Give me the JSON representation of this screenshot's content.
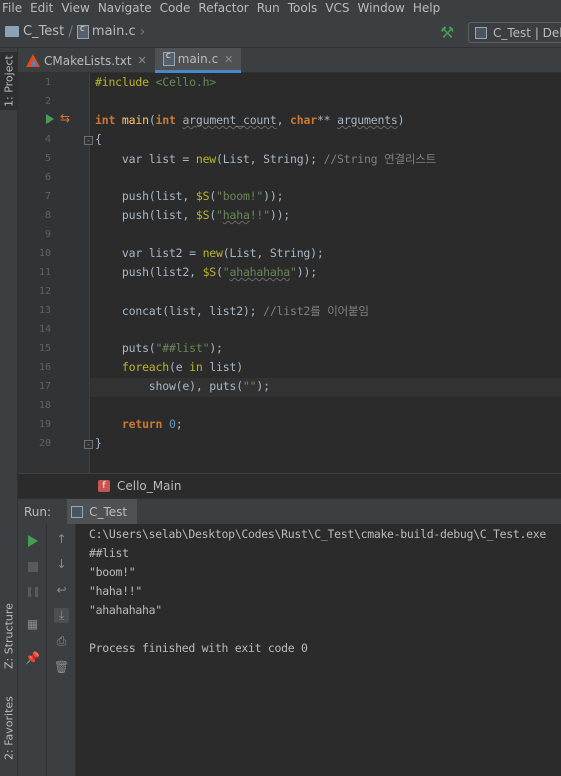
{
  "menu": [
    "File",
    "Edit",
    "View",
    "Navigate",
    "Code",
    "Refactor",
    "Run",
    "Tools",
    "VCS",
    "Window",
    "Help"
  ],
  "nav": {
    "project": "C_Test",
    "file": "main.c",
    "run_config": "C_Test | Deb"
  },
  "left_tools": {
    "project_tab": "1: Project",
    "structure_tab": "Z: Structure",
    "favorites_tab": "2: Favorites"
  },
  "tabs": [
    {
      "label": "CMakeLists.txt",
      "icon": "cmake-icon",
      "active": false
    },
    {
      "label": "main.c",
      "icon": "c-file-icon",
      "active": true
    }
  ],
  "line_numbers": [
    "1",
    "2",
    "3",
    "4",
    "5",
    "6",
    "7",
    "8",
    "9",
    "10",
    "11",
    "12",
    "13",
    "14",
    "15",
    "16",
    "17",
    "18",
    "19",
    "20"
  ],
  "code": {
    "l1_a": "#include ",
    "l1_b": "<Cello.h>",
    "l3_kw1": "int",
    "l3_fn": "main",
    "l3_kw2": "int",
    "l3_p1": "argument_count",
    "l3_kw3": "char",
    "l3_stars": "** ",
    "l3_p2": "arguments",
    "l4": "{",
    "l5_a": "    var list = ",
    "l5_new": "new",
    "l5_b": "(List, String); ",
    "l5_cmt": "//String 연결리스트",
    "l7_a": "    push(list, ",
    "l7_mac": "$S",
    "l7_str": "\"boom!\"",
    "l7_b": "));",
    "l8_a": "    push(list, ",
    "l8_mac": "$S",
    "l8_str1": "\"",
    "l8_str2": "haha",
    "l8_str3": "!!\"",
    "l8_b": "));",
    "l10_a": "    var list2 = ",
    "l10_new": "new",
    "l10_b": "(List, String);",
    "l11_a": "    push(list2, ",
    "l11_mac": "$S",
    "l11_str1": "\"",
    "l11_str2": "ahahahaha",
    "l11_str3": "\"",
    "l11_b": "));",
    "l13_a": "    concat(list, list2); ",
    "l13_cmt": "//list2를 이어붙임",
    "l15_a": "    puts(",
    "l15_str": "\"##list\"",
    "l15_b": ");",
    "l16_kw": "    foreach",
    "l16_a": "(e ",
    "l16_in": "in",
    "l16_b": " list)",
    "l17_a": "        show(e), puts(",
    "l17_str": "\"\"",
    "l17_b": ");",
    "l19_kw": "    return ",
    "l19_num": "0",
    "l19_b": ";",
    "l20": "}"
  },
  "breadcrumb_fn": "Cello_Main",
  "run_panel": {
    "label": "Run:",
    "tab": "C_Test"
  },
  "console": [
    "C:\\Users\\selab\\Desktop\\Codes\\Rust\\C_Test\\cmake-build-debug\\C_Test.exe",
    "##list",
    "\"boom!\"",
    "\"haha!!\"",
    "\"ahahahaha\"",
    "",
    "Process finished with exit code 0"
  ]
}
